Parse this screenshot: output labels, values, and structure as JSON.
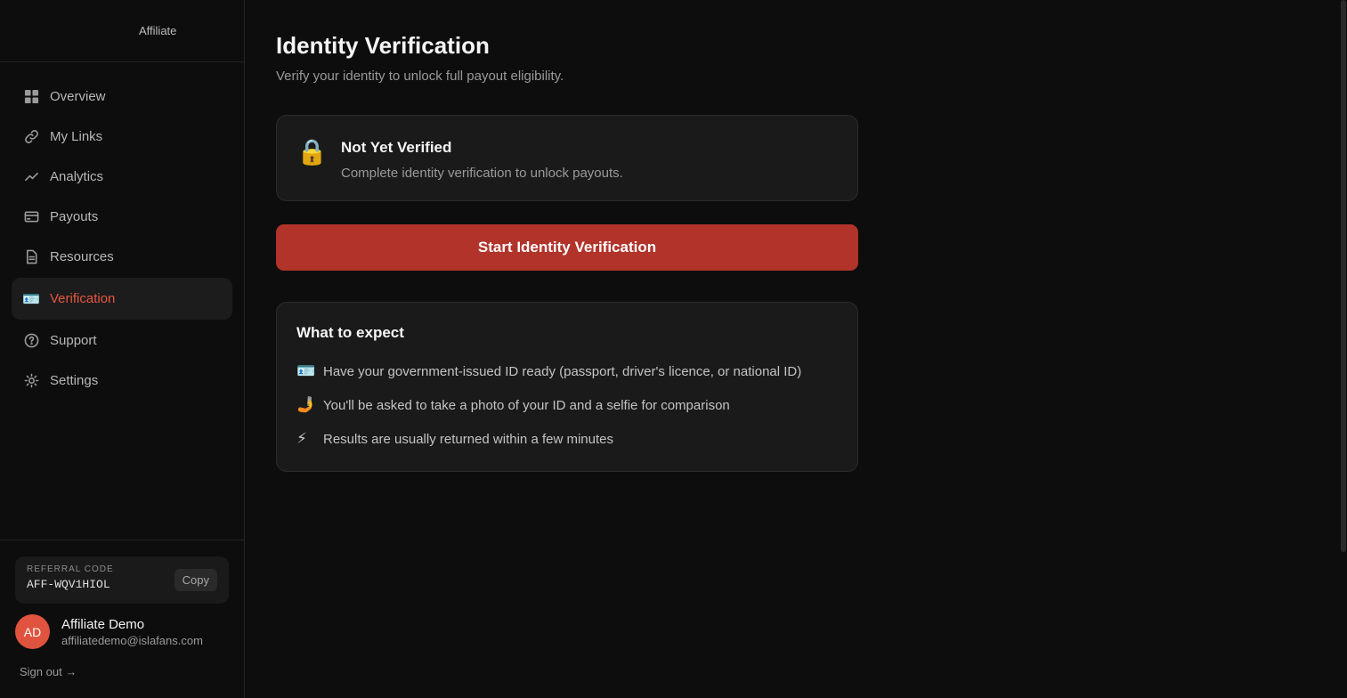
{
  "brand": {
    "label": "Affiliate"
  },
  "sidebar": {
    "items": [
      {
        "label": "Overview",
        "icon": "grid-icon"
      },
      {
        "label": "My Links",
        "icon": "link-icon"
      },
      {
        "label": "Analytics",
        "icon": "trend-icon"
      },
      {
        "label": "Payouts",
        "icon": "card-icon"
      },
      {
        "label": "Resources",
        "icon": "document-icon"
      },
      {
        "label": "Verification",
        "icon": "id-card-icon",
        "active": true
      },
      {
        "label": "Support",
        "icon": "help-icon"
      },
      {
        "label": "Settings",
        "icon": "gear-icon"
      }
    ]
  },
  "referral": {
    "label": "REFERRAL CODE",
    "code": "AFF-WQV1HIOL",
    "copy_label": "Copy"
  },
  "user": {
    "initials": "AD",
    "name": "Affiliate Demo",
    "email": "affiliatedemo@islafans.com",
    "signout": "Sign out →"
  },
  "main": {
    "title": "Identity Verification",
    "subtitle": "Verify your identity to unlock full payout eligibility.",
    "status": {
      "icon": "🔒",
      "title": "Not Yet Verified",
      "description": "Complete identity verification to unlock payouts."
    },
    "start_button": "Start Identity Verification",
    "expect": {
      "title": "What to expect",
      "items": [
        {
          "icon": "🪪",
          "text": "Have your government-issued ID ready (passport, driver's licence, or national ID)"
        },
        {
          "icon": "🤳",
          "text": "You'll be asked to take a photo of your ID and a selfie for comparison"
        },
        {
          "icon": "⚡",
          "text": "Results are usually returned within a few minutes"
        }
      ]
    }
  },
  "colors": {
    "accent": "#e8553f",
    "button": "#b1332a",
    "background": "#0d0d0d",
    "card": "#1a1a1a"
  }
}
